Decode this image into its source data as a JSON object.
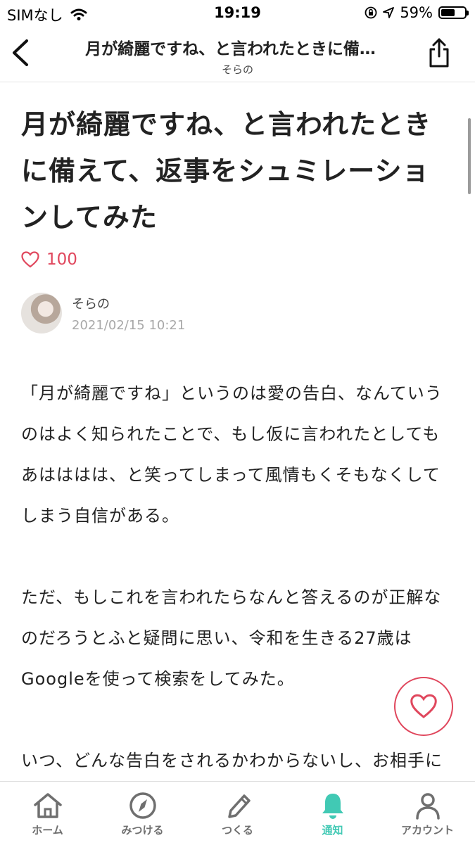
{
  "status_bar": {
    "carrier": "SIMなし",
    "time": "19:19",
    "battery": "59%",
    "battery_level": 0.59
  },
  "nav": {
    "title": "月が綺麗ですね、と言われたときに備…",
    "author": "そらの"
  },
  "article": {
    "title": "月が綺麗ですね、と言われたときに備えて、返事をシュミレーションしてみた",
    "likes": "100",
    "author_name": "そらの",
    "date": "2021/02/15 10:21",
    "paragraphs": [
      "「月が綺麗ですね」というのは愛の告白、なんていうのはよく知られたことで、もし仮に言われたとしてもあはははは、と笑ってしまって風情もくそもなくしてしまう自信がある。",
      "ただ、もしこれを言われたらなんと答えるのが正解なのだろうとふと疑問に思い、令和を生きる27歳はGoogleを使って検索をしてみた。",
      "いつ、どんな告白をされるかわからないし、お相手によってはそれを笑い飛ばすような人ではな"
    ]
  },
  "tabs": [
    {
      "label": "ホーム",
      "icon": "home-icon"
    },
    {
      "label": "みつける",
      "icon": "compass-icon"
    },
    {
      "label": "つくる",
      "icon": "pencil-icon"
    },
    {
      "label": "通知",
      "icon": "bell-icon"
    },
    {
      "label": "アカウント",
      "icon": "person-icon"
    }
  ],
  "colors": {
    "accent": "#e0475d",
    "active_tab": "#41c9b4",
    "inactive_tab": "#6f6f6f"
  }
}
